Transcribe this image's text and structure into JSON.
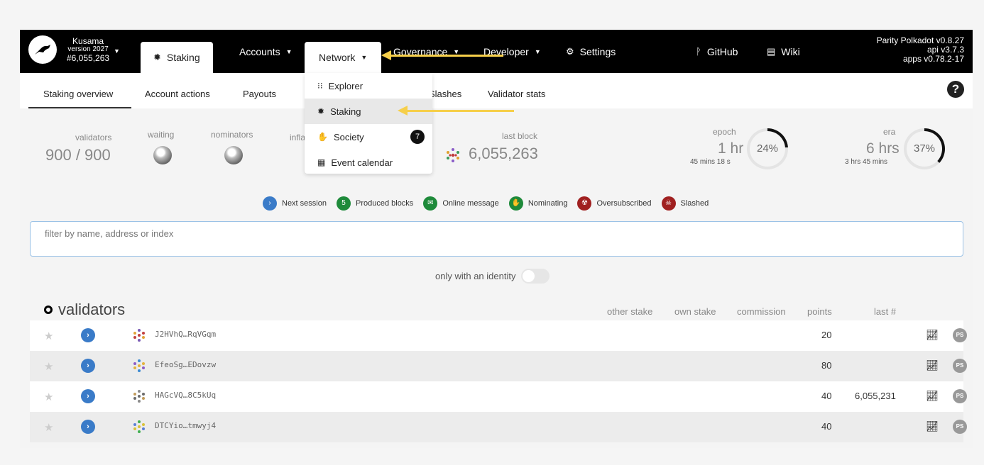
{
  "chain": {
    "name": "Kusama",
    "version": "version 2027",
    "block": "#6,055,263"
  },
  "nav": {
    "tabs": [
      {
        "label": "Staking",
        "icon": "staking-icon",
        "glyph": "✹"
      },
      {
        "label": "Accounts"
      },
      {
        "label": "Network"
      },
      {
        "label": "Governance"
      },
      {
        "label": "Developer"
      },
      {
        "label": "Settings",
        "icon": "gears-icon",
        "glyph": "⚙"
      },
      {
        "label": "GitHub",
        "icon": "code-branch-icon",
        "glyph": "ᚹ"
      },
      {
        "label": "Wiki",
        "icon": "book-icon",
        "glyph": "▤"
      }
    ],
    "versions": [
      "Parity Polkadot v0.8.27",
      "api v3.7.3",
      "apps v0.78.2-17"
    ]
  },
  "subnav": {
    "items": [
      "Staking overview",
      "Account actions",
      "Payouts",
      "Slashes",
      "Validator stats"
    ]
  },
  "dropdown": {
    "items": [
      {
        "label": "Explorer",
        "icon": "grid-icon",
        "glyph": "⁝⁝"
      },
      {
        "label": "Staking",
        "icon": "staking-icon",
        "glyph": "✹"
      },
      {
        "label": "Society",
        "icon": "hand-icon",
        "glyph": "✋",
        "badge": "7"
      },
      {
        "label": "Event calendar",
        "icon": "calendar-icon",
        "glyph": "▦"
      }
    ]
  },
  "summary": {
    "validators_label": "validators",
    "validators_value": "900 / 900",
    "waiting_label": "waiting",
    "nominators_label": "nominators",
    "inflation_label": "infla",
    "last_block_label": "last block",
    "last_block_value": "6,055,263",
    "epoch_label": "epoch",
    "epoch_value": "1 hr",
    "epoch_sub": "45 mins 18 s",
    "epoch_percent": "24%",
    "epoch_fraction": 0.24,
    "era_label": "era",
    "era_value": "6 hrs",
    "era_sub": "3 hrs 45 mins",
    "era_percent": "37%",
    "era_fraction": 0.37
  },
  "legend": [
    {
      "label": "Next session",
      "color": "#3a7bc8",
      "glyph": "›"
    },
    {
      "label": "Produced blocks",
      "color": "#1e8a3a",
      "glyph": "5"
    },
    {
      "label": "Online message",
      "color": "#1e8a3a",
      "glyph": "✉"
    },
    {
      "label": "Nominating",
      "color": "#1e8a3a",
      "glyph": "✋"
    },
    {
      "label": "Oversubscribed",
      "color": "#a02020",
      "glyph": "☢"
    },
    {
      "label": "Slashed",
      "color": "#a02020",
      "glyph": "☠"
    }
  ],
  "filter": {
    "placeholder": "filter by name, address or index"
  },
  "identity_toggle": {
    "label": "only with an identity"
  },
  "table": {
    "title": "validators",
    "columns": [
      "other stake",
      "own stake",
      "commission",
      "points",
      "last #"
    ],
    "rows": [
      {
        "address": "J2HVhQ…RqVGqm",
        "points": "20",
        "last": ""
      },
      {
        "address": "EfeoSg…EDovzw",
        "points": "80",
        "last": ""
      },
      {
        "address": "HAGcVQ…8C5kUq",
        "points": "40",
        "last": "6,055,231"
      },
      {
        "address": "DTCYio…tmwyj4",
        "points": "40",
        "last": ""
      }
    ],
    "ps_label": "PS"
  },
  "colors": {
    "topbar": "#000000",
    "accent": "#3a7bc8",
    "arrow": "#f6cf4a"
  }
}
